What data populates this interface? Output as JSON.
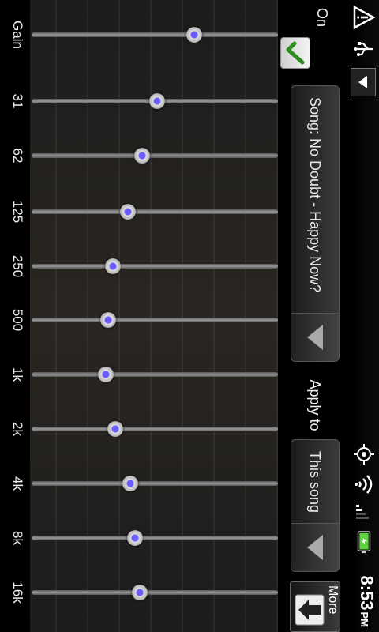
{
  "status_bar": {
    "time": "8:53",
    "ampm": "PM",
    "icons": [
      "warning-icon",
      "usb-icon",
      "dropdown-arrow-icon",
      "gps-icon",
      "wifi-icon",
      "signal-icon",
      "battery-icon"
    ]
  },
  "onoff": {
    "label": "On",
    "checked": true
  },
  "song": {
    "label": "Song: No Doubt - Happy Now?"
  },
  "apply": {
    "label": "Apply to",
    "value": "This song"
  },
  "more": {
    "label": "More"
  },
  "equalizer": {
    "bands": [
      {
        "label": "Gain",
        "level": 0.34
      },
      {
        "label": "31",
        "level": 0.49
      },
      {
        "label": "62",
        "level": 0.55
      },
      {
        "label": "125",
        "level": 0.61
      },
      {
        "label": "250",
        "level": 0.67
      },
      {
        "label": "500",
        "level": 0.69
      },
      {
        "label": "1k",
        "level": 0.7
      },
      {
        "label": "2k",
        "level": 0.66
      },
      {
        "label": "4k",
        "level": 0.6
      },
      {
        "label": "8k",
        "level": 0.58
      },
      {
        "label": "16k",
        "level": 0.56
      }
    ]
  },
  "colors": {
    "accent": "#6a5cff",
    "check": "#2e8b1f",
    "battery": "#5bd13b"
  }
}
